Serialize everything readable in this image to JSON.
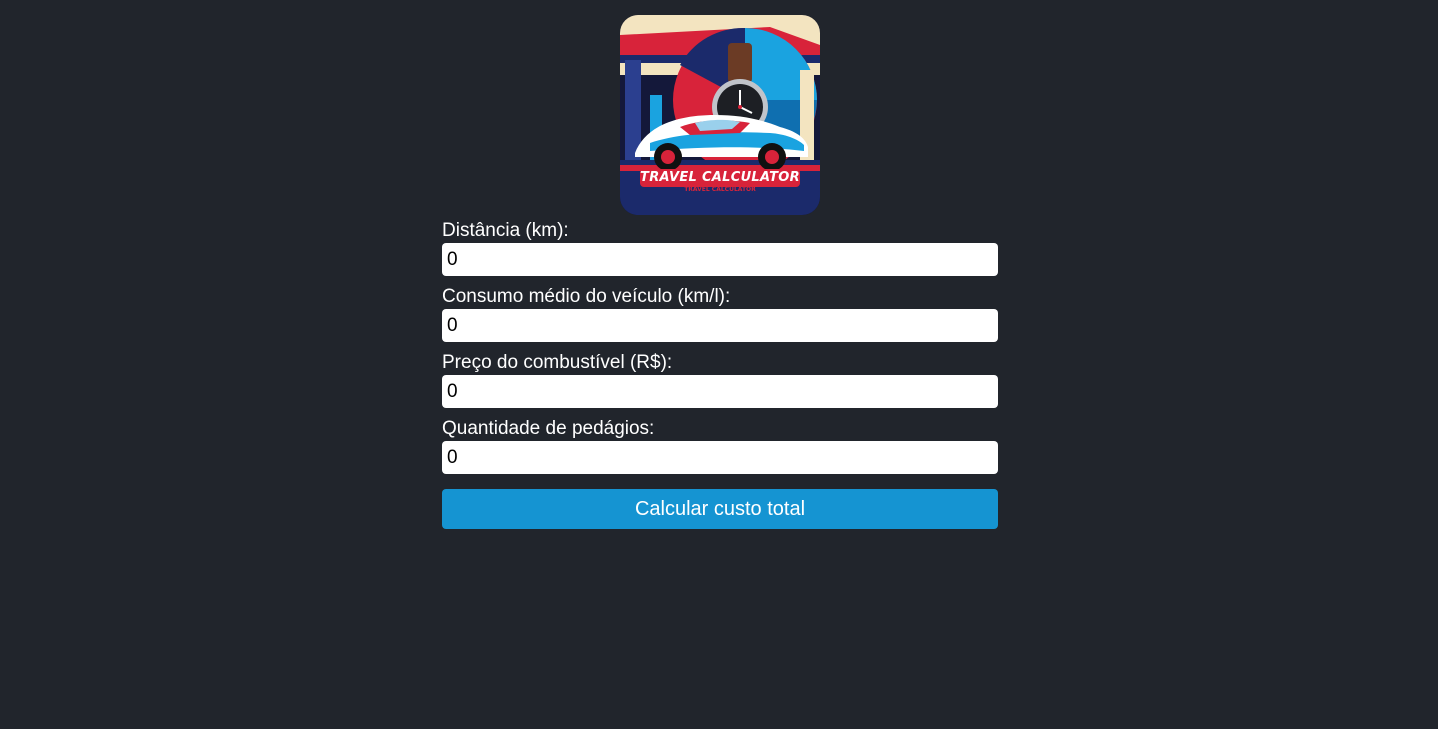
{
  "logo": {
    "text_main": "TRAVEL CALCULATOR",
    "text_sub": "TRAVEL CALCULATOR",
    "colors": {
      "red": "#d8233a",
      "blue": "#1aa3e0",
      "navy": "#14183a",
      "cream": "#f3e4c0"
    }
  },
  "form": {
    "fields": [
      {
        "label": "Distância (km):",
        "value": "0"
      },
      {
        "label": "Consumo médio do veículo (km/l):",
        "value": "0"
      },
      {
        "label": "Preço do combustível (R$):",
        "value": "0"
      },
      {
        "label": "Quantidade de pedágios:",
        "value": "0"
      }
    ],
    "button_label": "Calcular custo total"
  },
  "colors": {
    "background": "#21252c",
    "button": "#1594d2",
    "input": "#ffffff"
  }
}
